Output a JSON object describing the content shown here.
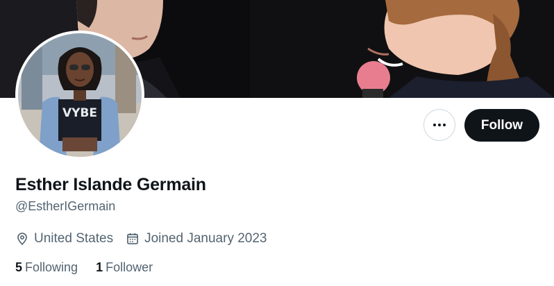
{
  "colors": {
    "text_primary": "#0f1419",
    "text_secondary": "#536471",
    "follow_bg": "#0f1419",
    "border": "#cfd9de"
  },
  "header": {
    "banner_image": "banner-photo",
    "avatar_image": "profile-photo"
  },
  "actions": {
    "more_icon": "more-icon",
    "follow_label": "Follow"
  },
  "profile": {
    "display_name": "Esther Islande Germain",
    "handle": "@EstherIGermain",
    "location_icon": "location-pin-icon",
    "location": "United States",
    "joined_icon": "calendar-icon",
    "joined": "Joined January 2023"
  },
  "stats": {
    "following_count": "5",
    "following_label": "Following",
    "followers_count": "1",
    "followers_label": "Follower"
  }
}
